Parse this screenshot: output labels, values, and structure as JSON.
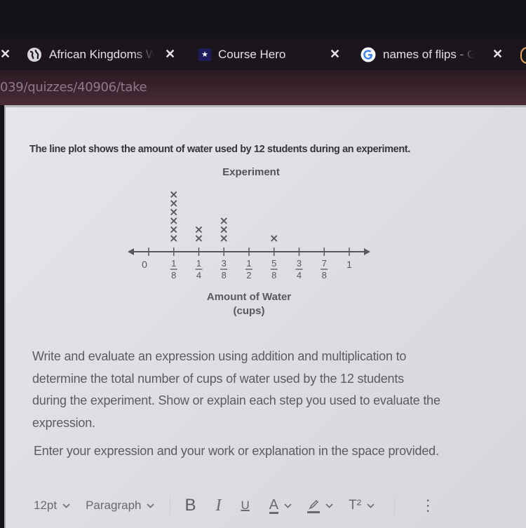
{
  "browser": {
    "tabs": [
      {
        "icon": "globe-icon",
        "title": "African Kingdoms W",
        "close": "✕"
      },
      {
        "icon": "star-icon",
        "title": "Course Hero",
        "close": "✕"
      },
      {
        "icon": "google-icon",
        "title": "names of flips - Go",
        "close": "✕"
      }
    ],
    "left_close": "✕",
    "url": "039/quizzes/40906/take"
  },
  "question": {
    "prompt": "The line plot shows the amount of water used by 12 students during an experiment.",
    "lines": [
      "Write and evaluate an expression using addition and multiplication to",
      "determine the total number of cups of water used by the 12 students",
      "during the experiment. Show or explain each step you used to evaluate the",
      "expression."
    ],
    "instruction": "Enter your expression and your work or explanation in the space provided."
  },
  "chart_data": {
    "type": "scatter",
    "subtype": "line-plot",
    "title": "Experiment",
    "xlabel": "Amount of Water",
    "xlabel_unit": "(cups)",
    "marker": "×",
    "xlim": [
      0,
      1
    ],
    "ticks": [
      {
        "value": 0,
        "label": "0"
      },
      {
        "value": 0.125,
        "num": "1",
        "den": "8"
      },
      {
        "value": 0.25,
        "num": "1",
        "den": "4"
      },
      {
        "value": 0.375,
        "num": "3",
        "den": "8"
      },
      {
        "value": 0.5,
        "num": "1",
        "den": "2"
      },
      {
        "value": 0.625,
        "num": "5",
        "den": "8"
      },
      {
        "value": 0.75,
        "num": "3",
        "den": "4"
      },
      {
        "value": 0.875,
        "num": "7",
        "den": "8"
      },
      {
        "value": 1,
        "label": "1"
      }
    ],
    "points": [
      {
        "x": 0.125,
        "label": "1/8",
        "count": 6
      },
      {
        "x": 0.25,
        "label": "1/4",
        "count": 2
      },
      {
        "x": 0.375,
        "label": "3/8",
        "count": 3
      },
      {
        "x": 0.625,
        "label": "5/8",
        "count": 1
      }
    ],
    "total_students": 12
  },
  "editor": {
    "font_size": "12pt",
    "block_format": "Paragraph",
    "bold": "B",
    "italic": "I",
    "underline": "U",
    "text_color": "A",
    "superscript": "T²",
    "more": "⋮",
    "chevron": "⌄"
  }
}
